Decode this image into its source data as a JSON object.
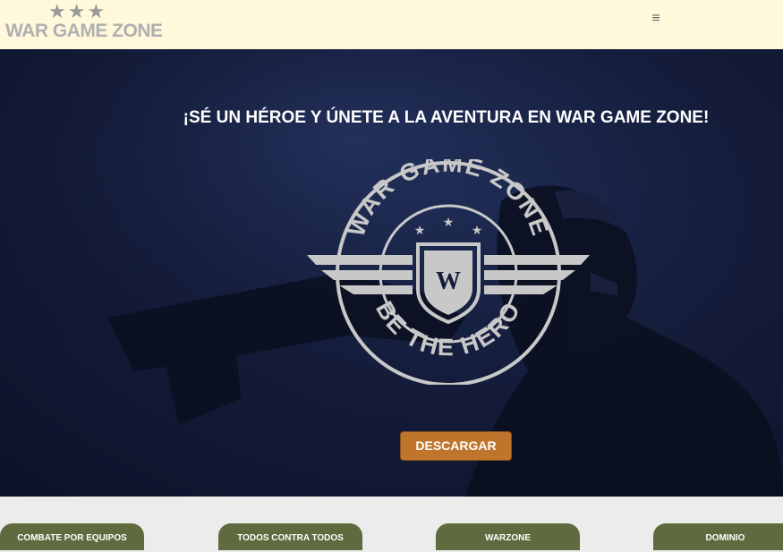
{
  "header": {
    "logo_stars": "★★★",
    "logo_text": "WAR GAME ZONE",
    "menu_icon": "hamburger-icon",
    "menu_glyph": "≡"
  },
  "hero": {
    "title": "¡SÉ UN HÉROE Y ÚNETE A LA AVENTURA EN WAR GAME ZONE!",
    "emblem_top_text": "WAR GAME ZONE",
    "emblem_bottom_text": "BE THE HERO",
    "emblem_monogram": "W",
    "download_label": "DESCARGAR"
  },
  "game_modes": [
    {
      "label": "COMBATE POR EQUIPOS"
    },
    {
      "label": "TODOS CONTRA TODOS"
    },
    {
      "label": "WARZONE"
    },
    {
      "label": "DOMINIO"
    }
  ],
  "colors": {
    "header_bg": "#fff8da",
    "download_bg": "#c0752d",
    "mode_bg": "#5d6b3e",
    "emblem": "#c8c8c8"
  }
}
